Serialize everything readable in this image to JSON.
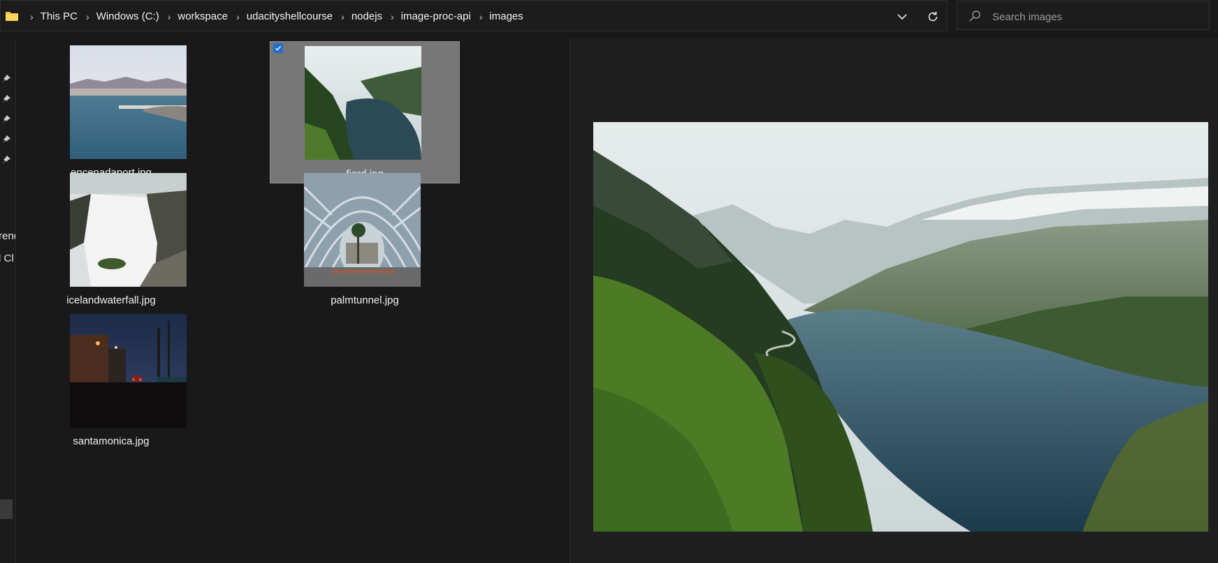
{
  "breadcrumb": {
    "items": [
      "This PC",
      "Windows (C:)",
      "workspace",
      "udacityshellcourse",
      "nodejs",
      "image-proc-api",
      "images"
    ]
  },
  "search": {
    "placeholder": "Search images"
  },
  "nav": {
    "partial_labels": [
      "rend",
      "l Cl"
    ]
  },
  "files": [
    {
      "name": "encenadaport.jpg",
      "selected": false
    },
    {
      "name": "fjord.jpg",
      "selected": true
    },
    {
      "name": "icelandwaterfall.jpg",
      "selected": false
    },
    {
      "name": "palmtunnel.jpg",
      "selected": false
    },
    {
      "name": "santamonica.jpg",
      "selected": false
    }
  ],
  "preview": {
    "file": "fjord.jpg"
  },
  "colors": {
    "accent": "#1f6fd1",
    "selection": "#777777",
    "background": "#191919"
  }
}
